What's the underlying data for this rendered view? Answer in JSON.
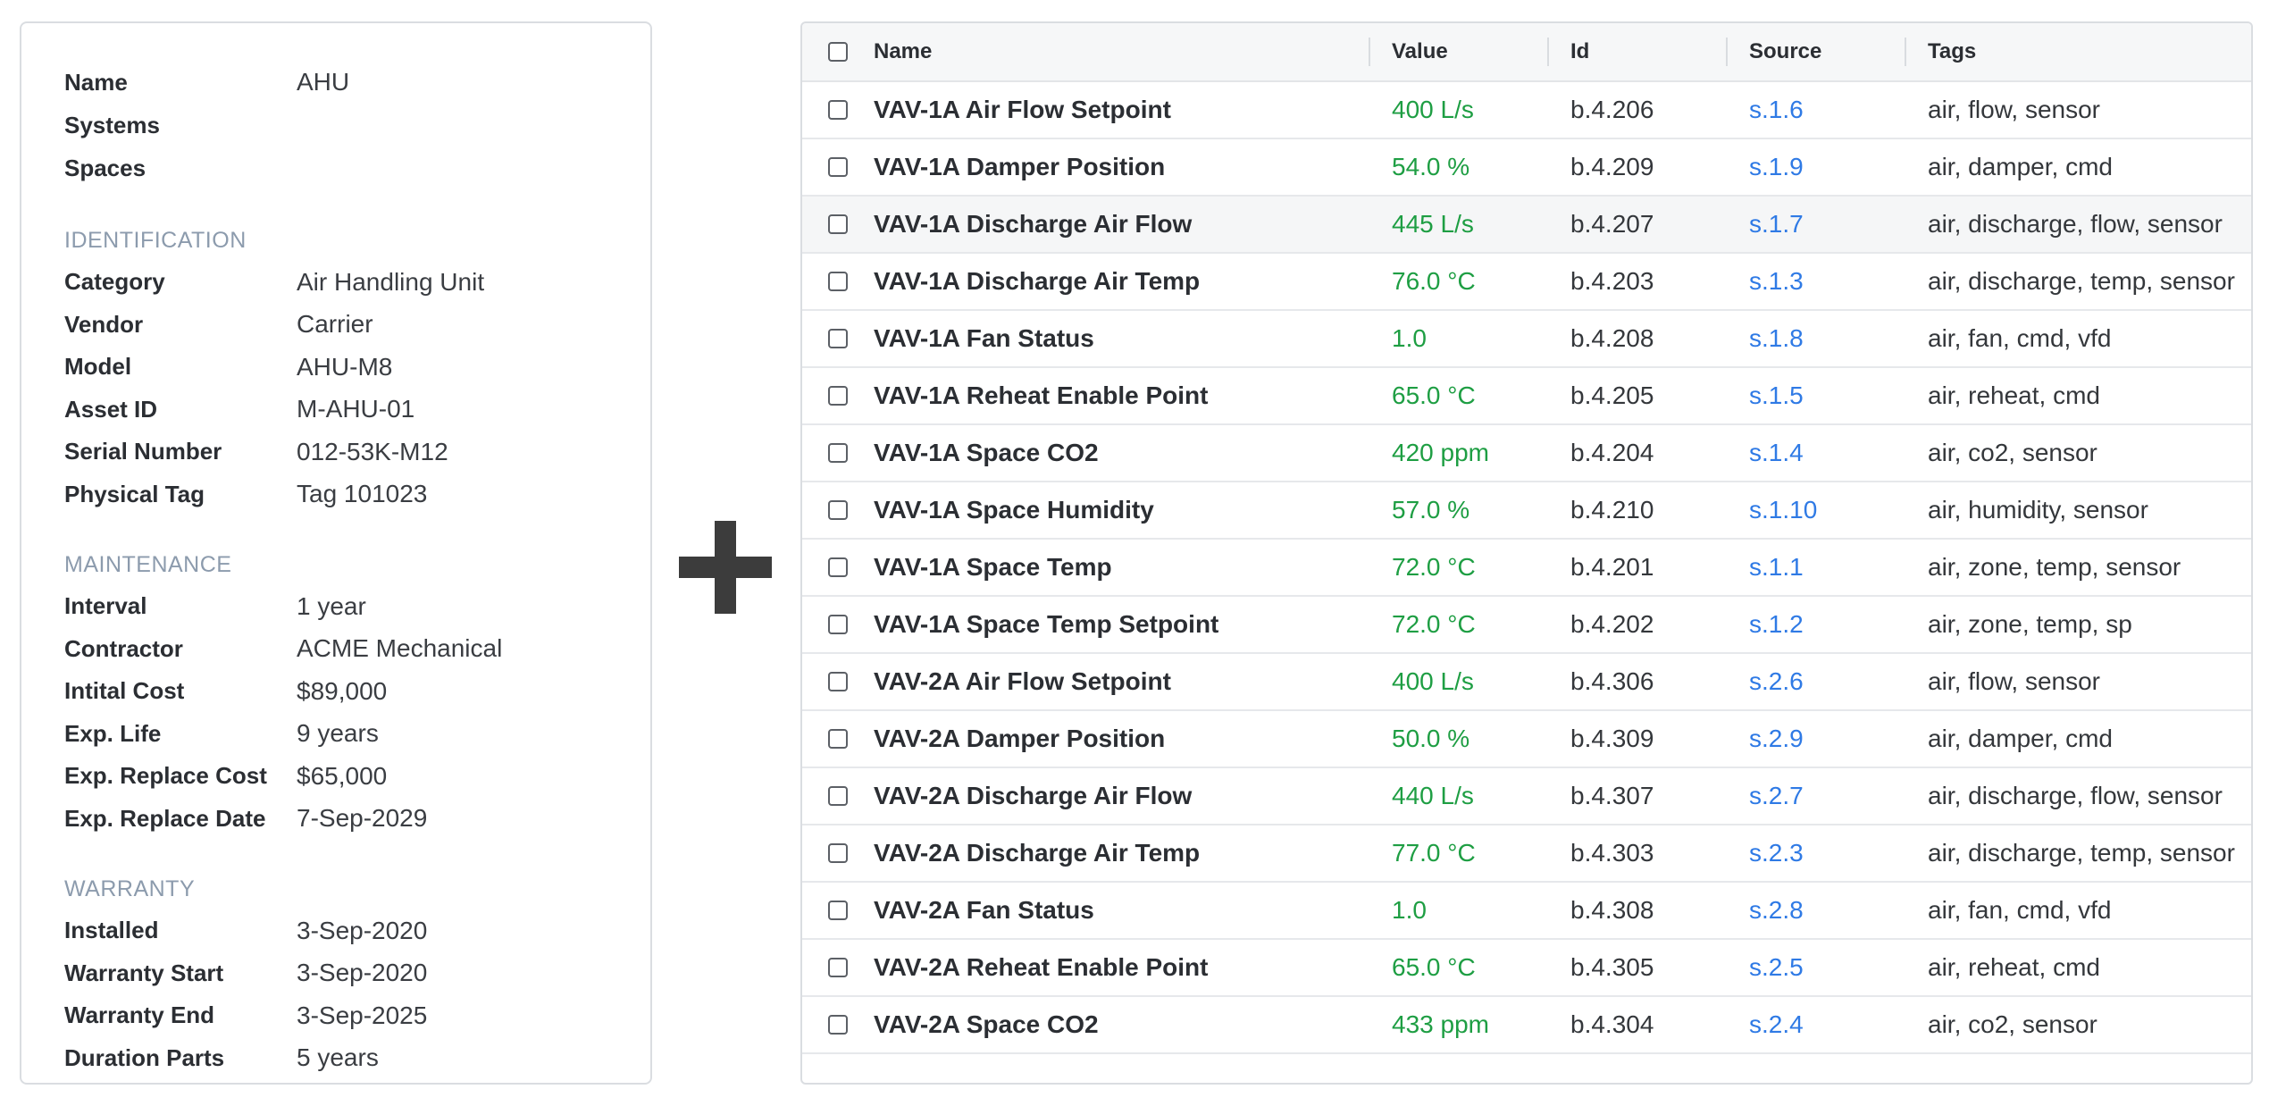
{
  "details": {
    "top": [
      {
        "label": "Name",
        "value": "AHU"
      },
      {
        "label": "Systems",
        "value": ""
      },
      {
        "label": "Spaces",
        "value": ""
      }
    ],
    "sections": [
      {
        "title": "IDENTIFICATION",
        "fields": [
          {
            "label": "Category",
            "value": "Air Handling Unit"
          },
          {
            "label": "Vendor",
            "value": "Carrier"
          },
          {
            "label": "Model",
            "value": "AHU-M8"
          },
          {
            "label": "Asset ID",
            "value": "M-AHU-01"
          },
          {
            "label": "Serial Number",
            "value": "012-53K-M12"
          },
          {
            "label": "Physical Tag",
            "value": "Tag 101023"
          }
        ]
      },
      {
        "title": "MAINTENANCE",
        "fields": [
          {
            "label": "Interval",
            "value": "1 year"
          },
          {
            "label": "Contractor",
            "value": "ACME Mechanical"
          },
          {
            "label": "Intital Cost",
            "value": "$89,000"
          },
          {
            "label": "Exp. Life",
            "value": "9 years"
          },
          {
            "label": "Exp. Replace Cost",
            "value": "$65,000"
          },
          {
            "label": "Exp. Replace Date",
            "value": "7-Sep-2029"
          }
        ]
      },
      {
        "title": "WARRANTY",
        "fields": [
          {
            "label": "Installed",
            "value": "3-Sep-2020"
          },
          {
            "label": "Warranty Start",
            "value": "3-Sep-2020"
          },
          {
            "label": "Warranty End",
            "value": "3-Sep-2025"
          },
          {
            "label": "Duration Parts",
            "value": "5 years"
          }
        ]
      }
    ]
  },
  "table": {
    "headers": {
      "name": "Name",
      "value": "Value",
      "id": "Id",
      "source": "Source",
      "tags": "Tags"
    },
    "rows": [
      {
        "name": "VAV-1A Air Flow Setpoint",
        "value": "400 L/s",
        "id": "b.4.206",
        "source": "s.1.6",
        "tags": "air, flow, sensor"
      },
      {
        "name": "VAV-1A Damper Position",
        "value": "54.0 %",
        "id": "b.4.209",
        "source": "s.1.9",
        "tags": "air, damper, cmd"
      },
      {
        "name": "VAV-1A Discharge Air Flow",
        "value": "445 L/s",
        "id": "b.4.207",
        "source": "s.1.7",
        "tags": "air, discharge, flow, sensor"
      },
      {
        "name": "VAV-1A Discharge Air Temp",
        "value": "76.0 °C",
        "id": "b.4.203",
        "source": "s.1.3",
        "tags": "air, discharge, temp, sensor"
      },
      {
        "name": "VAV-1A Fan Status",
        "value": "1.0",
        "id": "b.4.208",
        "source": "s.1.8",
        "tags": "air, fan, cmd, vfd"
      },
      {
        "name": "VAV-1A Reheat Enable Point",
        "value": "65.0 °C",
        "id": "b.4.205",
        "source": "s.1.5",
        "tags": "air, reheat, cmd"
      },
      {
        "name": "VAV-1A Space CO2",
        "value": "420 ppm",
        "id": "b.4.204",
        "source": "s.1.4",
        "tags": "air, co2, sensor"
      },
      {
        "name": "VAV-1A Space Humidity",
        "value": "57.0 %",
        "id": "b.4.210",
        "source": "s.1.10",
        "tags": "air, humidity, sensor"
      },
      {
        "name": "VAV-1A Space Temp",
        "value": "72.0 °C",
        "id": "b.4.201",
        "source": "s.1.1",
        "tags": "air, zone, temp, sensor"
      },
      {
        "name": "VAV-1A Space Temp Setpoint",
        "value": "72.0 °C",
        "id": "b.4.202",
        "source": "s.1.2",
        "tags": "air, zone, temp, sp"
      },
      {
        "name": "VAV-2A Air Flow Setpoint",
        "value": "400 L/s",
        "id": "b.4.306",
        "source": "s.2.6",
        "tags": "air, flow, sensor"
      },
      {
        "name": "VAV-2A Damper Position",
        "value": "50.0 %",
        "id": "b.4.309",
        "source": "s.2.9",
        "tags": "air, damper, cmd"
      },
      {
        "name": "VAV-2A Discharge Air Flow",
        "value": "440 L/s",
        "id": "b.4.307",
        "source": "s.2.7",
        "tags": "air, discharge, flow, sensor"
      },
      {
        "name": "VAV-2A Discharge Air Temp",
        "value": "77.0 °C",
        "id": "b.4.303",
        "source": "s.2.3",
        "tags": "air, discharge, temp, sensor"
      },
      {
        "name": "VAV-2A Fan Status",
        "value": "1.0",
        "id": "b.4.308",
        "source": "s.2.8",
        "tags": "air, fan, cmd, vfd"
      },
      {
        "name": "VAV-2A Reheat Enable Point",
        "value": "65.0 °C",
        "id": "b.4.305",
        "source": "s.2.5",
        "tags": "air, reheat, cmd"
      },
      {
        "name": "VAV-2A Space CO2",
        "value": "433 ppm",
        "id": "b.4.304",
        "source": "s.2.4",
        "tags": "air, co2, sensor"
      }
    ],
    "hover_row": 2
  },
  "colors": {
    "value_green": "#1e9e43",
    "source_blue": "#2f7ae5",
    "section_gray": "#8c9bad",
    "border": "#dadde1"
  },
  "icons": {
    "plus": "plus-icon",
    "checkbox": "checkbox-icon"
  }
}
